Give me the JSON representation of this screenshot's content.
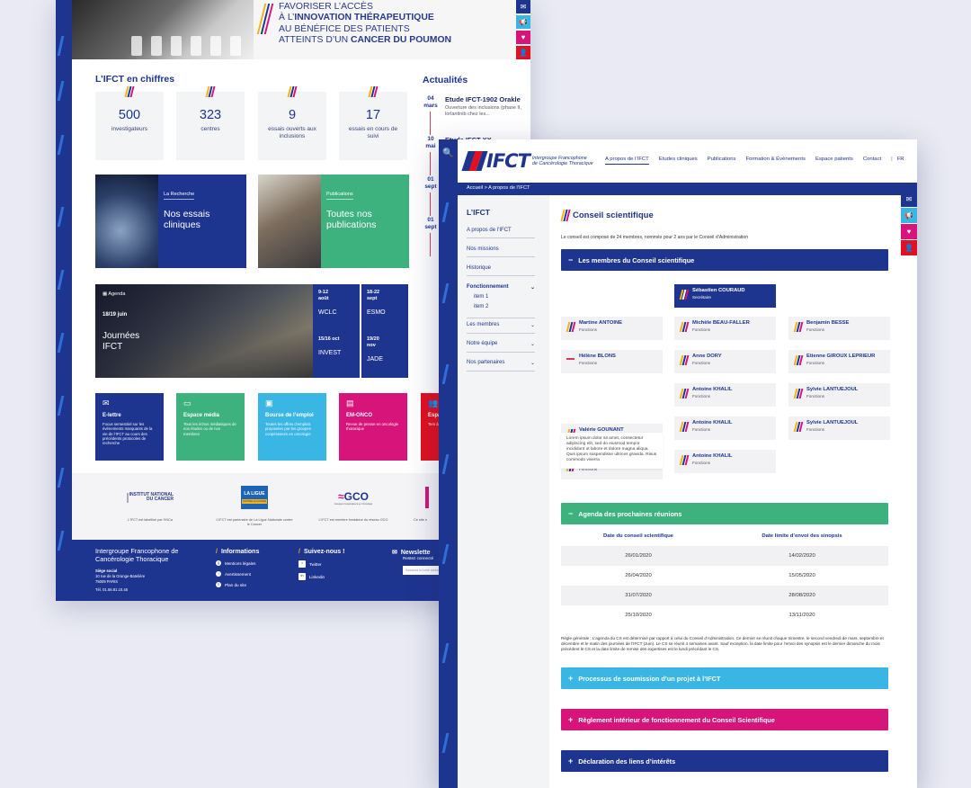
{
  "back": {
    "hero": {
      "line1": "FAVORISER L’ACCÈS",
      "line2_a": "À L’",
      "line2_b": "INNOVATION THÉRAPEUTIQUE",
      "line3": "AU BÉNÉFICE DES PATIENTS",
      "line4_a": "ATTEINTS D’UN ",
      "line4_b": "CANCER DU POUMON"
    },
    "figures_title": "L’IFCT en chiffres",
    "stats": [
      {
        "num": "500",
        "label": "investigateurs"
      },
      {
        "num": "323",
        "label": "centres"
      },
      {
        "num": "9",
        "label": "essais ouverts aux inclusions"
      },
      {
        "num": "17",
        "label": "essais en cours de suivi"
      }
    ],
    "news_title": "Actualités",
    "news": [
      {
        "day": "04",
        "month": "mars",
        "title": "Etude IFCT-1902 Orakle",
        "desc": "Ouverture des inclusions (phase II, lorlantinib chez les..."
      },
      {
        "day": "10",
        "month": "mai",
        "title": "Etude IFCT-XX",
        "desc": ""
      },
      {
        "day": "01",
        "month": "sept",
        "title": "",
        "desc": ""
      },
      {
        "day": "01",
        "month": "sept",
        "title": "",
        "desc": ""
      }
    ],
    "cards": [
      {
        "tag": "La Recherche",
        "title": "Nos essais cliniques"
      },
      {
        "tag": "Publications",
        "title": "Toutes nos publications"
      }
    ],
    "agenda": {
      "tag": "Agenda",
      "date": "18/19 juin",
      "title": "Journées IFCT",
      "events": [
        {
          "date": "9-12 août",
          "name": "WCLC"
        },
        {
          "date": "18-22 sept",
          "name": "ESMO"
        },
        {
          "date": "15/16 oct",
          "name": "INVEST"
        },
        {
          "date": "19/20 nov",
          "name": "JADE"
        }
      ]
    },
    "tiles": [
      {
        "title": "E-lettre",
        "desc": "Focus semestriel sur les événements marquants de la vie de l’IFCT au cours des précédents protocoles de recherche"
      },
      {
        "title": "Espace média",
        "desc": "Tous les échos médiatiques de nos études ou de nos membres"
      },
      {
        "title": "Bourse de l’emploi",
        "desc": "Toutes les offres d’emplois proposées par les groupes coopérateurs en oncologie"
      },
      {
        "title": "EM-ONCO",
        "desc": "Revue de presse en oncologie thoracique"
      },
      {
        "title": "Espa",
        "desc": "Tem à diff"
      }
    ],
    "partners": [
      {
        "logo": "INSTITUT NATIONAL DU CANCER",
        "caption": "L’IFCT est labellisé par l’INCa"
      },
      {
        "logo": "LA LIGUE",
        "logo_sub": "CONTRE LE CANCER",
        "caption": "L’IFCT est partenaire de La Ligue Nationale contre le Cancer"
      },
      {
        "logo": "GCO",
        "logo_sub": "Groupes Coopérateurs en Oncologie",
        "caption": "L’IFCT est membre fondateur du réseau GCO"
      },
      {
        "logo": "",
        "caption": "Ce site e"
      }
    ],
    "footer": {
      "org": "Intergroupe Francophone de Cancérologie Thoracique",
      "addr_h": "Siège social",
      "addr1": "10 rue de la Grange-Batelière",
      "addr2": "75009 PARIS",
      "tel": "Tél. 01.56.81.10.45",
      "info_h": "Informations",
      "info_links": [
        "Mentions légales",
        "Avertissement",
        "Plan du site"
      ],
      "follow_h": "Suivez-nous !",
      "follow_links": [
        "Twitter",
        "Linkedin"
      ],
      "newsletter_h": "Newslette",
      "newsletter_sub": "Restez connecté",
      "newsletter_ph": "Saisissez ici votre adresse e-mail"
    }
  },
  "front": {
    "logo": "IFCT",
    "logo_sub1": "Intergroupe Francophone",
    "logo_sub2": "de Cancérologie Thoracique",
    "nav": [
      "A propos de l’IFCT",
      "Etudes cliniques",
      "Publications",
      "Formation & Évènements",
      "Espace patients",
      "Contact",
      "FR"
    ],
    "breadcrumb": "Accueil > A propos de l’IFCT",
    "side": {
      "title": "L’IFCT",
      "items": [
        "A propos de l’IFCT",
        "Nos missions",
        "Historique",
        "Fonctionnement",
        "Les membres",
        "Notre équipe",
        "Nos partenaires"
      ],
      "subitems": [
        "item 1",
        "item 2"
      ]
    },
    "page_title": "Conseil scientifique",
    "intro": "Le conseil est composé de 24 membres, nommés pour 2 ans par le Conseil d’Administration",
    "members_header": "Les membres du Conseil scientifique",
    "secretary": {
      "name": "Sébastien COURAUD",
      "role": "Secrétaire"
    },
    "members": [
      {
        "name": "Martine ANTOINE",
        "role": "Fonctions"
      },
      {
        "name": "Michèle BEAU-FALLER",
        "role": "Fonctions"
      },
      {
        "name": "Benjamin BESSE",
        "role": "Fonctions"
      },
      {
        "name": "Hélène BLONS",
        "role": "Fonctions"
      },
      {
        "name": "Anne DORY",
        "role": "Fonctions"
      },
      {
        "name": "Etienne GIROUX LEPRIEUR",
        "role": "Fonctions"
      },
      {
        "name": "Antoine KHALIL",
        "role": "Fonctions"
      },
      {
        "name": "Sylvie LANTUEJOUL",
        "role": "Fonctions"
      },
      {
        "name": "Valérie GOUNANT",
        "role": "Fonctions"
      },
      {
        "name": "Antoine KHALIL",
        "role": "Fonctions"
      },
      {
        "name": "Sylvie LANTUEJOUL",
        "role": "Fonctions"
      },
      {
        "name": "Valérie GOUNANT",
        "role": "Fonctions"
      },
      {
        "name": "Antoine KHALIL",
        "role": "Fonctions"
      }
    ],
    "bio": "Lorem ipsum dolor sit amet, consectetur adipiscing elit, sed do eiusmod tempor incididunt ut labore et dolore magna aliqua. Quis ipsum suspendisse ultrices gravida. Risus commodo viverra",
    "agenda_header": "Agenda des prochaines réunions",
    "table": {
      "head": [
        "Date du conseil scientifique",
        "Date limite d’envoi des sinopsis"
      ],
      "rows": [
        [
          "26/01/2020",
          "14/02/2020"
        ],
        [
          "26/04/2020",
          "15/05/2020"
        ],
        [
          "31/07/2020",
          "28/08/2020"
        ],
        [
          "25/10/2020",
          "13/11/2020"
        ]
      ]
    },
    "rule": "Règle générale : L’agenda du CS est déterminé par rapport à celui du Conseil d’Administration. Ce dernier se réunit chaque trimestre, le second vendredi de mars, septembre et décembre et le matin des journées de l’IFCT (Juin). Le CS se réunit 4 semaines avant. Sauf exception, la date limite pour l’envoi des synopsis est le dernier dimanche du mois précédent le CS et la date limite de remise des expertises est le lundi précédant le CS.",
    "acc_process": "Processus de soumission d’un projet à l’IFCT",
    "acc_reglement": "Règlement intérieur de fonctionnement du Conseil Scientifique",
    "acc_declaration": "Déclaration des liens d’intérêts"
  },
  "colors": {
    "navy": "#1e3590",
    "green": "#3db27f",
    "cyan": "#39b6e4",
    "magenta": "#d6147a",
    "red": "#e3101f"
  }
}
